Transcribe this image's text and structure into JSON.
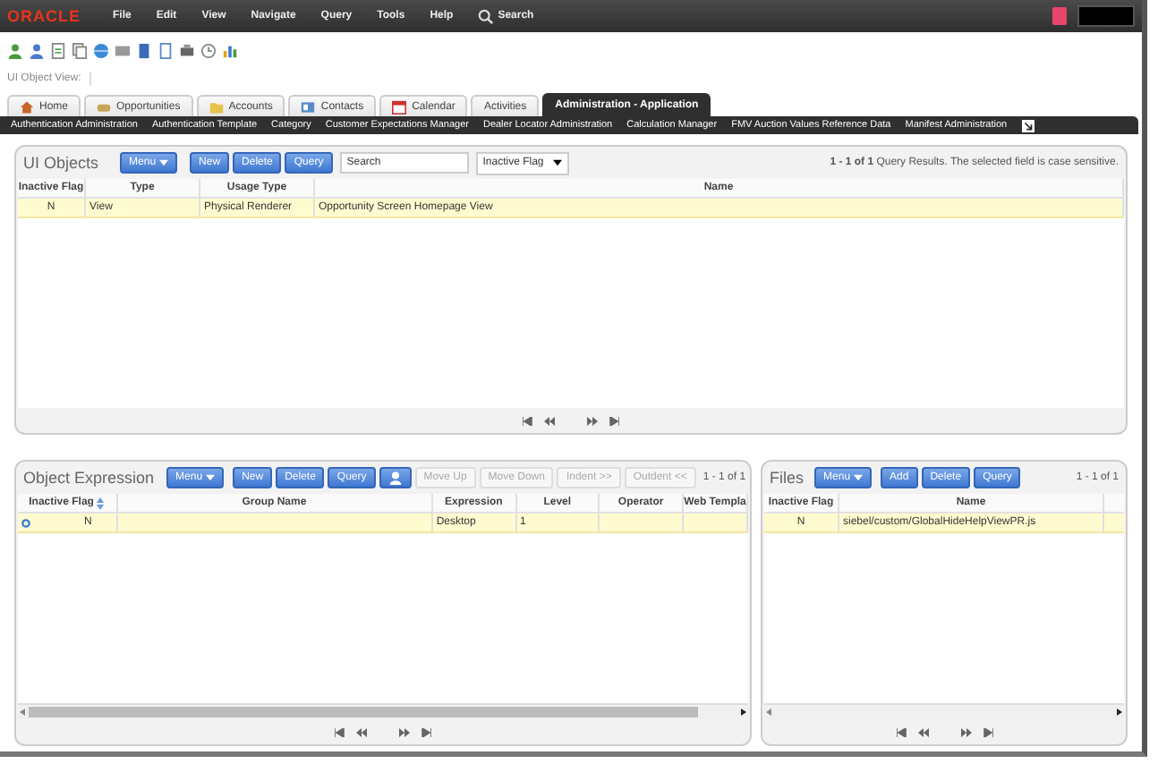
{
  "menu_bar": {
    "logo": "ORACLE",
    "items": [
      "File",
      "Edit",
      "View",
      "Navigate",
      "Query",
      "Tools",
      "Help"
    ],
    "search": "Search"
  },
  "breadcrumb": "UI Object View:",
  "tabs": [
    {
      "label": "Home",
      "selected": false
    },
    {
      "label": "Opportunities",
      "selected": false
    },
    {
      "label": "Accounts",
      "selected": false
    },
    {
      "label": "Contacts",
      "selected": false
    },
    {
      "label": "Calendar",
      "selected": false
    },
    {
      "label": "Activities",
      "selected": false
    },
    {
      "label": "Administration - Application",
      "selected": true
    }
  ],
  "subtabs": [
    "Authentication Administration",
    "Authentication Template",
    "Category",
    "Customer Expectations Manager",
    "Dealer Locator Administration",
    "Calculation Manager",
    "FMV Auction Values Reference Data",
    "Manifest Administration"
  ],
  "ui_objects": {
    "title": "UI Objects",
    "buttons": [
      {
        "kind": "menu",
        "label": "Menu",
        "disabled": false
      },
      {
        "kind": "button",
        "label": "New",
        "disabled": false
      },
      {
        "kind": "button",
        "label": "Delete",
        "disabled": false
      },
      {
        "kind": "button",
        "label": "Query",
        "disabled": false
      }
    ],
    "search": {
      "placeholder": "Search"
    },
    "field": "Inactive Flag",
    "status": "**1 - 1 of 1** Query Results.  The selected field is case sensitive.",
    "columns": [
      "Inactive Flag",
      "Type",
      "Usage Type",
      "Name"
    ],
    "rows": [
      {
        "cells": [
          "N",
          "View",
          "Physical Renderer",
          "Opportunity Screen Homepage View"
        ],
        "selected": true
      }
    ]
  },
  "object_expression": {
    "title": "Object Expression",
    "buttons": [
      {
        "kind": "menu",
        "label": "Menu",
        "disabled": false
      },
      {
        "kind": "button",
        "label": "New",
        "disabled": false
      },
      {
        "kind": "button",
        "label": "Delete",
        "disabled": false
      },
      {
        "kind": "button",
        "label": "Query",
        "disabled": false
      },
      {
        "kind": "icon",
        "disabled": false
      },
      {
        "kind": "button",
        "label": "Move Up",
        "disabled": true
      },
      {
        "kind": "button",
        "label": "Move Down",
        "disabled": true
      },
      {
        "kind": "button",
        "label": "Indent >>",
        "disabled": true
      },
      {
        "kind": "button",
        "label": "Outdent <<",
        "disabled": true
      }
    ],
    "count": "1 - 1 of 1",
    "columns": [
      "Inactive Flag",
      "Group Name",
      "Expression",
      "Level",
      "Operator",
      "Web Templa"
    ],
    "rows": [
      {
        "cells": [
          "N",
          "",
          "Desktop",
          "1",
          "",
          ""
        ],
        "selected": true
      }
    ]
  },
  "files": {
    "title": "Files",
    "buttons": [
      {
        "kind": "menu",
        "label": "Menu",
        "disabled": false
      },
      {
        "kind": "button",
        "label": "Add",
        "disabled": false
      },
      {
        "kind": "button",
        "label": "Delete",
        "disabled": false
      },
      {
        "kind": "button",
        "label": "Query",
        "disabled": false
      }
    ],
    "count": "1 - 1 of 1",
    "columns": [
      "Inactive Flag",
      "Name"
    ],
    "rows": [
      {
        "cells": [
          "N",
          "siebel/custom/GlobalHideHelpViewPR.js"
        ],
        "selected": true
      }
    ]
  }
}
